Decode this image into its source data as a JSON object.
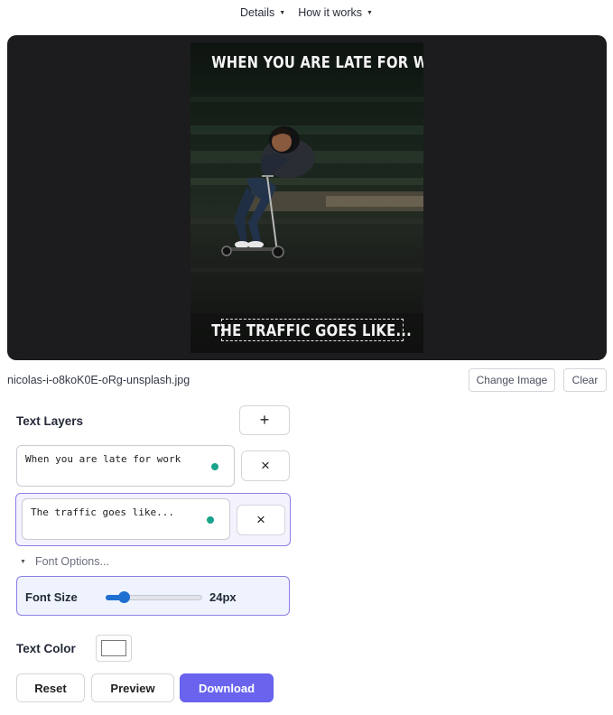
{
  "nav": {
    "details_label": "Details",
    "how_label": "How it works"
  },
  "preview": {
    "top_caption": "WHEN YOU ARE LATE FOR WORK",
    "bottom_caption": "THE TRAFFIC GOES LIKE..."
  },
  "file": {
    "name": "nicolas-i-o8koK0E-oRg-unsplash.jpg",
    "change_label": "Change Image",
    "clear_label": "Clear"
  },
  "layers": {
    "title": "Text Layers",
    "add_label": "+",
    "items": [
      {
        "text": "When you are late for work",
        "remove_label": "×"
      },
      {
        "text": "The traffic goes like...",
        "remove_label": "×"
      }
    ]
  },
  "font_options": {
    "toggle_label": "Font Options...",
    "size_label": "Font Size",
    "size_value": "24px",
    "slider_fraction": 0.2
  },
  "text_color": {
    "label": "Text Color",
    "value": "#ffffff"
  },
  "actions": {
    "reset_label": "Reset",
    "preview_label": "Preview",
    "download_label": "Download"
  },
  "colors": {
    "accent": "#6963ee",
    "active_border": "#8f7ee6",
    "slider": "#1f6fd1",
    "dot": "#19a38b"
  }
}
